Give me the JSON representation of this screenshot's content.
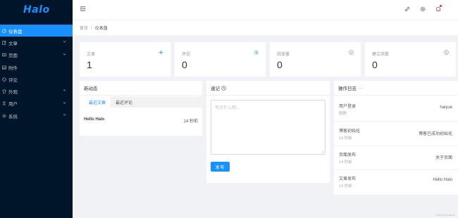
{
  "app": {
    "logo": "Halo"
  },
  "sidebar": {
    "items": [
      {
        "label": "仪表盘",
        "icon": "dashboard-icon",
        "active": true,
        "has_children": false
      },
      {
        "label": "文章",
        "icon": "form-icon",
        "active": false,
        "has_children": true
      },
      {
        "label": "页面",
        "icon": "read-icon",
        "active": false,
        "has_children": true
      },
      {
        "label": "附件",
        "icon": "picture-icon",
        "active": false,
        "has_children": false
      },
      {
        "label": "评论",
        "icon": "message-icon",
        "active": false,
        "has_children": false
      },
      {
        "label": "外观",
        "icon": "skin-icon",
        "active": false,
        "has_children": true
      },
      {
        "label": "用户",
        "icon": "user-icon",
        "active": false,
        "has_children": true
      },
      {
        "label": "系统",
        "icon": "setting-icon",
        "active": false,
        "has_children": true
      }
    ]
  },
  "header": {
    "icons": [
      "menu-fold-icon",
      "link-icon",
      "setting-icon",
      "bell-icon"
    ]
  },
  "breadcrumb": {
    "home": "首页",
    "separator": "/",
    "current": "仪表盘"
  },
  "stats": [
    {
      "label": "文章",
      "value": "1",
      "icon": "plus-icon"
    },
    {
      "label": "评论",
      "value": "0",
      "icon": "unordered-list-icon"
    },
    {
      "label": "阅读量",
      "value": "0",
      "icon": "info-circle-icon"
    },
    {
      "label": "建立天数",
      "value": "0",
      "icon": "info-circle-icon"
    }
  ],
  "activity": {
    "title": "新动态",
    "tabs": [
      "最近文章",
      "最近评论"
    ],
    "active_tab": 0,
    "posts": [
      {
        "title": "Hello Halo",
        "time": "14 秒前"
      }
    ]
  },
  "memo": {
    "title": "速记",
    "placeholder": "写点什么吧...",
    "button": "发布"
  },
  "logs": {
    "title": "操作日志",
    "more": "···",
    "items": [
      {
        "type": "用户登录",
        "time": "刚刚",
        "content": "haiyue"
      },
      {
        "type": "博客初始化",
        "time": "14 秒前",
        "content": "博客已成功初始化"
      },
      {
        "type": "页面发布",
        "time": "14 秒前",
        "content": "关于页面"
      },
      {
        "type": "文章发布",
        "time": "14 秒前",
        "content": "Hello Halo"
      }
    ]
  },
  "watermark": "CSDN @haiyue",
  "colors": {
    "primary": "#1890ff",
    "sidebar_bg": "#001529",
    "badge": "#f5222d"
  }
}
